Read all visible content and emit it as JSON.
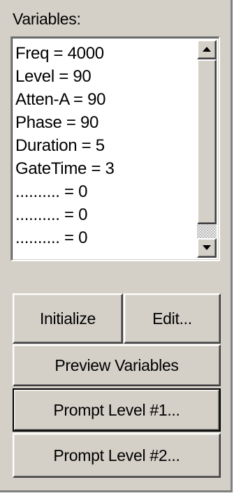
{
  "panel": {
    "title": "Variables:"
  },
  "variables": {
    "items": [
      "Freq = 4000",
      "Level = 90",
      "Atten-A = 90",
      "Phase = 90",
      "Duration = 5",
      "GateTime = 3",
      ".......... = 0",
      ".......... = 0",
      ".......... = 0"
    ],
    "scrollbar": {
      "up_icon": "scroll-up-arrow",
      "down_icon": "scroll-down-arrow"
    }
  },
  "buttons": {
    "initialize": "Initialize",
    "edit": "Edit...",
    "preview": "Preview Variables",
    "prompt1": "Prompt Level #1...",
    "prompt2": "Prompt Level #2..."
  },
  "colors": {
    "face": "#d4d0c8",
    "list_background": "#ffffff",
    "text": "#000000"
  }
}
